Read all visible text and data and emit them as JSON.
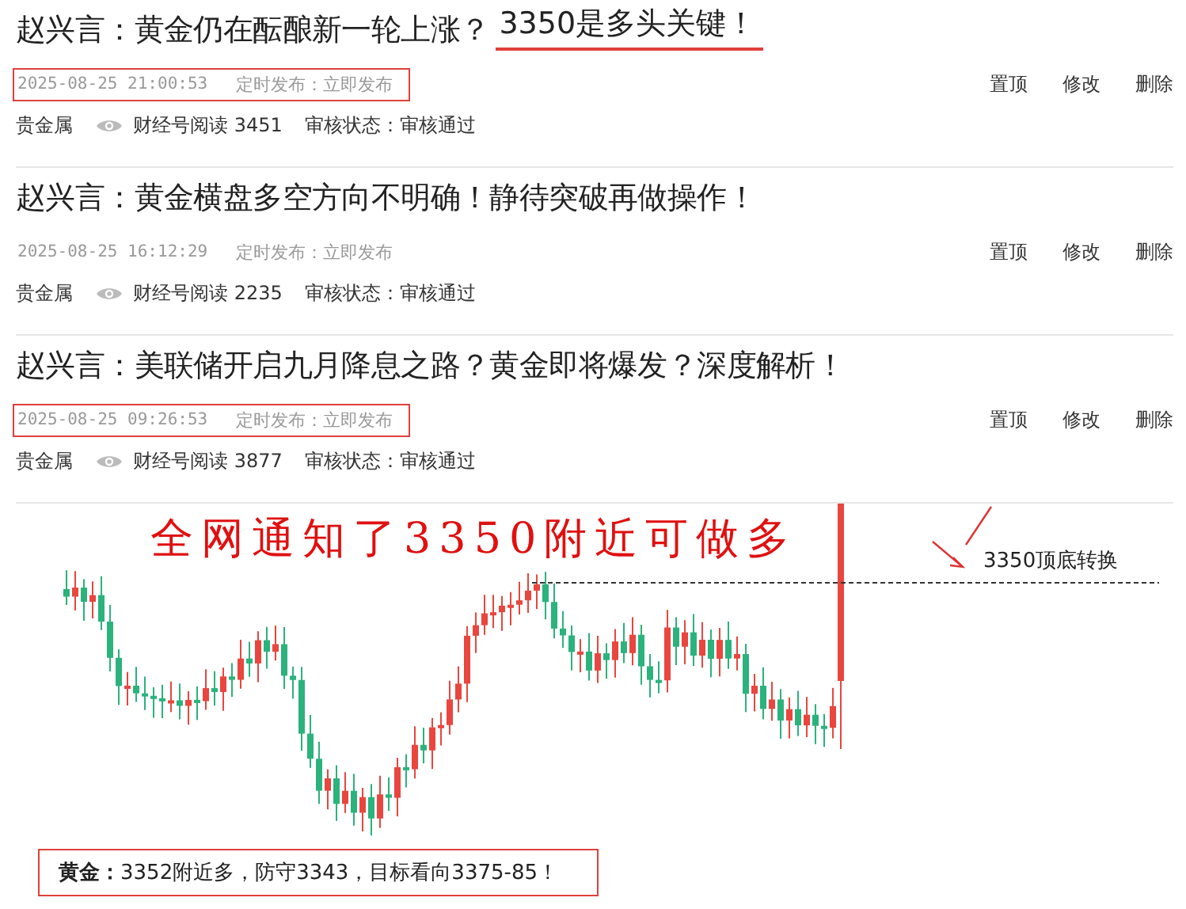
{
  "posts": [
    {
      "title": "赵兴言：黄金仍在酝酿新一轮上涨？",
      "title_marked": "3350是多头关键！",
      "date": "2025-08-25 21:00:53",
      "schedule": "定时发布：立即发布",
      "date_marked": true,
      "actions": [
        "置顶",
        "修改",
        "删除"
      ],
      "category": "贵金属",
      "reads": "财经号阅读 3451",
      "review": "审核状态：审核通过"
    },
    {
      "title": "赵兴言：黄金横盘多空方向不明确！静待突破再做操作！",
      "date": "2025-08-25 16:12:29",
      "schedule": "定时发布：立即发布",
      "date_marked": false,
      "actions": [
        "置顶",
        "修改",
        "删除"
      ],
      "category": "贵金属",
      "reads": "财经号阅读 2235",
      "review": "审核状态：审核通过"
    },
    {
      "title": "赵兴言：美联储开启九月降息之路？黄金即将爆发？深度解析！",
      "date": "2025-08-25 09:26:53",
      "schedule": "定时发布：立即发布",
      "date_marked": true,
      "actions": [
        "置顶",
        "修改",
        "删除"
      ],
      "category": "贵金属",
      "reads": "财经号阅读 3877",
      "review": "审核状态：审核通过"
    }
  ],
  "figure": {
    "headline": "全网通知了3350附近可做多",
    "level_label": "3350顶底转换",
    "caption": "**黄金：**3352附近多，防守3343，目标看向3375-85！"
  }
}
